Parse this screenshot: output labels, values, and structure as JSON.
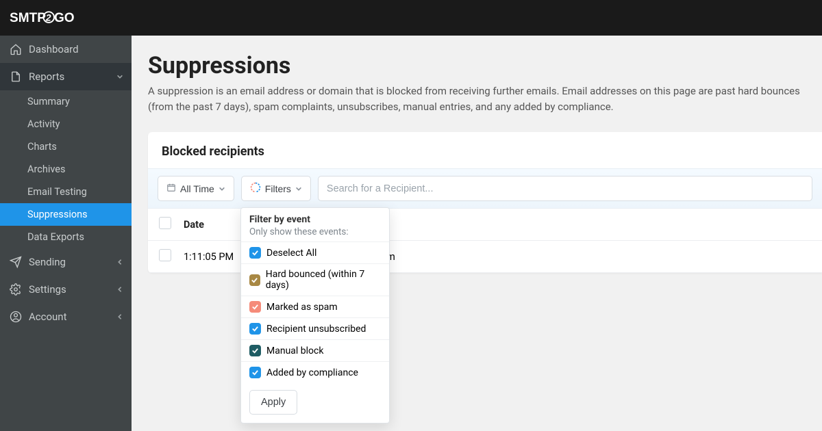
{
  "logo_text": "SMTP2GO",
  "sidebar": {
    "dashboard": "Dashboard",
    "reports": "Reports",
    "reports_items": [
      "Summary",
      "Activity",
      "Charts",
      "Archives",
      "Email Testing",
      "Suppressions",
      "Data Exports"
    ],
    "sending": "Sending",
    "settings": "Settings",
    "account": "Account"
  },
  "page": {
    "title": "Suppressions",
    "description": "A suppression is an email address or domain that is blocked from receiving further emails. Email addresses on this page are past hard bounces (from the past 7 days), spam complaints, unsubscribes, manual entries, and any added by compliance."
  },
  "blocked": {
    "title": "Blocked recipients",
    "time_filter": "All Time",
    "filters_label": "Filters",
    "search_placeholder": "Search for a Recipient...",
    "columns": {
      "date": "Date"
    },
    "rows": [
      {
        "time": "1:11:05 PM",
        "email_visible": "go.com"
      }
    ]
  },
  "filter_panel": {
    "heading": "Filter by event",
    "sub": "Only show these events:",
    "deselect": "Deselect All",
    "options": [
      {
        "label": "Hard bounced (within 7 days)",
        "color": "brown"
      },
      {
        "label": "Marked as spam",
        "color": "salmon"
      },
      {
        "label": "Recipient unsubscribed",
        "color": "blue"
      },
      {
        "label": "Manual block",
        "color": "teal"
      },
      {
        "label": "Added by compliance",
        "color": "blue"
      }
    ],
    "apply": "Apply"
  }
}
